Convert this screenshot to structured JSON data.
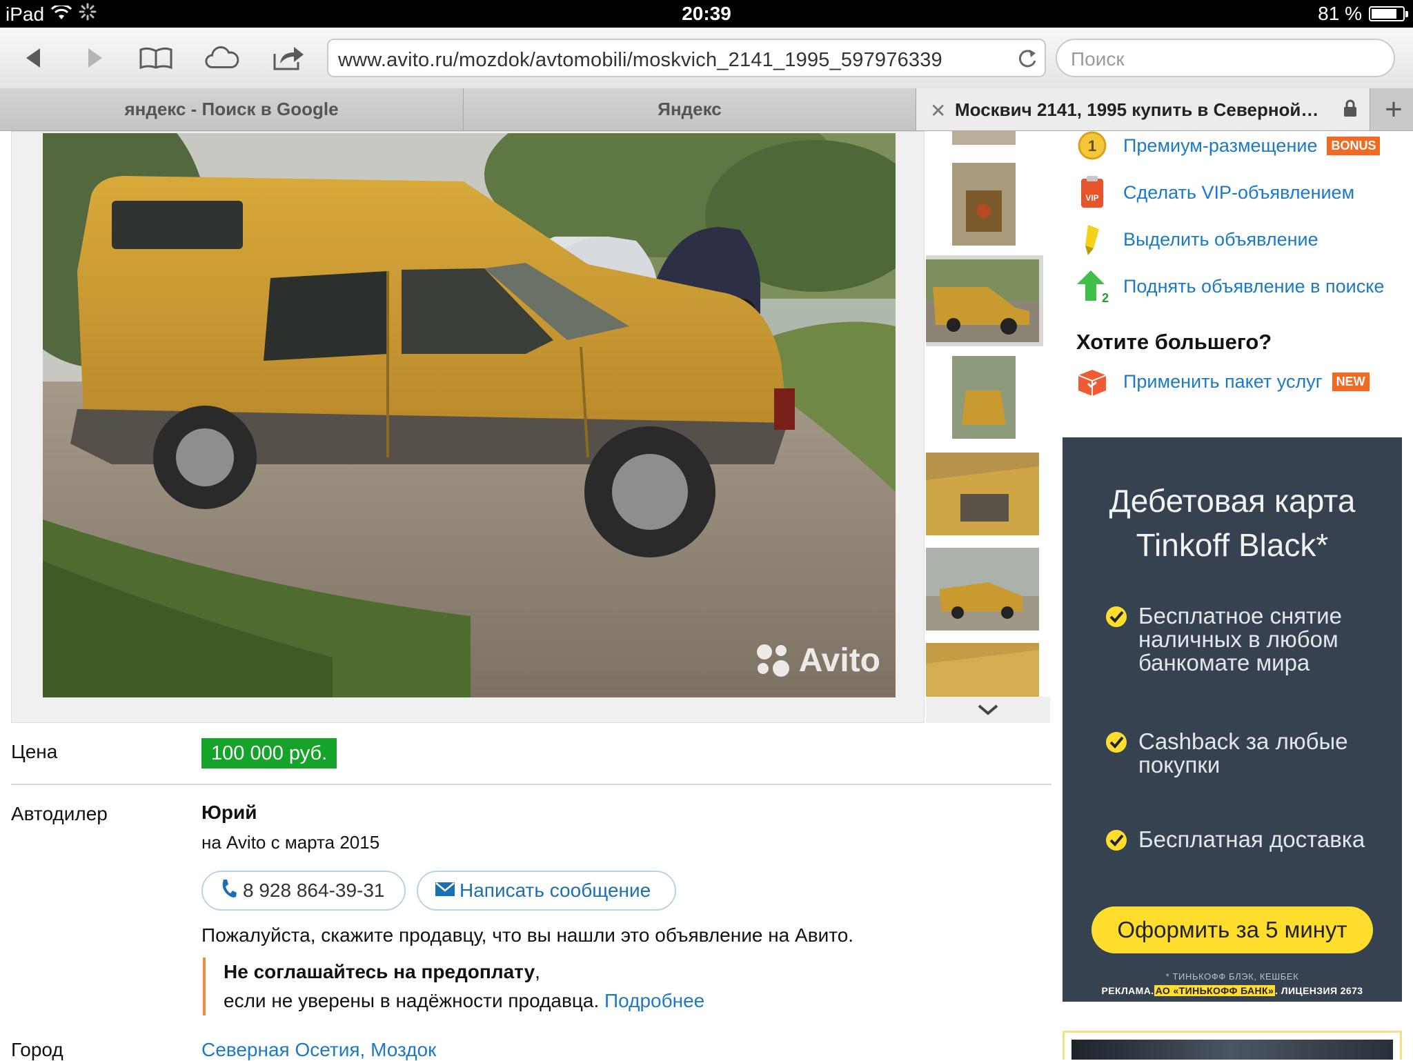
{
  "status_bar": {
    "device": "iPad",
    "time": "20:39",
    "battery_text": "81 %",
    "battery_level": 0.81
  },
  "toolbar": {
    "url": "www.avito.ru/mozdok/avtomobili/moskvich_2141_1995_597976339",
    "search_placeholder": "Поиск"
  },
  "tabs": [
    {
      "label": "яндекс - Поиск в Google",
      "active": false
    },
    {
      "label": "Яндекс",
      "active": false
    },
    {
      "label": "Москвич 2141, 1995 купить в Северной…",
      "active": true
    }
  ],
  "gallery": {
    "watermark": "Avito",
    "thumbnail_count": 7,
    "selected_thumbnail": 3
  },
  "listing": {
    "price_label": "Цена",
    "price": "100 000 руб.",
    "seller_label": "Автодилер",
    "seller_name": "Юрий",
    "seller_since": "на Avito с марта 2015",
    "phone": "8 928 864-39-31",
    "message_button": "Написать сообщение",
    "please_note": "Пожалуйста, скажите продавцу, что вы нашли это объявление на Авито.",
    "warning_bold": "Не соглашайтесь на предоплату",
    "warning_comma": ",",
    "warning_text": "если не уверены в надёжности продавца.",
    "warning_link": "Подробнее",
    "city_label": "Город",
    "city": "Северная Осетия, Моздок"
  },
  "sidebar": {
    "promos": [
      {
        "label": "Премиум-размещение",
        "badge": "BONUS",
        "icon": "premium-coin-icon"
      },
      {
        "label": "Сделать VIP-объявлением",
        "badge": "",
        "icon": "vip-icon"
      },
      {
        "label": "Выделить объявление",
        "badge": "",
        "icon": "highlighter-icon"
      },
      {
        "label": "Поднять объявление в поиске",
        "badge": "",
        "icon": "raise-arrow-icon"
      }
    ],
    "want_more": "Хотите большего?",
    "package": {
      "label": "Применить пакет услуг",
      "badge": "NEW",
      "icon": "package-box-icon"
    }
  },
  "ad": {
    "title_line1": "Дебетовая карта",
    "title_line2": "Tinkoff Black*",
    "bullets": [
      {
        "line1": "Бесплатное снятие",
        "line2": "наличных в любом",
        "line3": "банкомате мира"
      },
      {
        "line1": "Cashback за любые",
        "line2": "покупки",
        "line3": ""
      },
      {
        "line1": "Бесплатная доставка",
        "line2": "",
        "line3": ""
      }
    ],
    "cta": "Оформить за 5 минут",
    "footnote": "* ТИНЬКОФФ БЛЭК, КЕШБЕК",
    "legal_pre": "РЕКЛАМА.",
    "legal_bank": "АО «ТИНЬКОФФ БАНК»",
    "legal_post": ". ЛИЦЕНЗИЯ 2673",
    "accent": "#ffdd2d",
    "background": "#36424f"
  },
  "colors": {
    "link": "#1b79c7",
    "price_green": "#16a32a",
    "warning_border": "#f08a3a"
  }
}
